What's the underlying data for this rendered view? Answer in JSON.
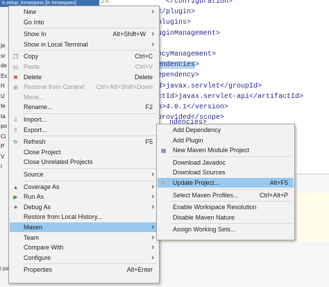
{
  "project_explorer": {
    "header_title": "e.setup_inmaspass [in inmaspass]",
    "stubs": [
      "ja",
      "sr",
      "de",
      "Ec",
      "H",
      "U",
      "te",
      "ta",
      "po",
      "Ci",
      "P",
      "V",
      "i"
    ],
    "bottom_tab": "i pa"
  },
  "editor": {
    "line_number": "24",
    "lines": [
      {
        "pre": "",
        "hl": "",
        "text": "  </configuration>"
      },
      {
        "pre": "",
        "hl": "",
        "text": "</plugin>"
      },
      {
        "pre": "",
        "hl": "",
        "text": "plugins>"
      },
      {
        "pre": "",
        "hl": "",
        "text": "uginManagement>"
      },
      {
        "pre": "",
        "hl": "",
        "text": ""
      },
      {
        "pre": "",
        "hl": "",
        "text": "ncyManagement>"
      },
      {
        "pre": "",
        "hl": "endencies",
        "text": ">"
      },
      {
        "pre": "",
        "hl": "",
        "text": "ependency>"
      },
      {
        "pre": "",
        "hl": "",
        "text": "d>javax.servlet</groupId>"
      },
      {
        "pre": "",
        "hl": "",
        "text": "ctId>javax.servlet-api</artifactId>"
      },
      {
        "pre": "",
        "hl": "",
        "text": "n>4.0.1</version>"
      },
      {
        "pre": "",
        "hl": "",
        "text": "provided</scope>"
      }
    ],
    "partial_line": "ndencies>"
  },
  "context_menu": {
    "items": [
      {
        "label": "New",
        "submenu": true
      },
      {
        "label": "Go Into"
      },
      {
        "sep": true
      },
      {
        "label": "Show In",
        "shortcut": "Alt+Shift+W",
        "submenu": true
      },
      {
        "label": "Show in Local Terminal",
        "submenu": true
      },
      {
        "sep": true
      },
      {
        "label": "Copy",
        "shortcut": "Ctrl+C",
        "icon": "copy-icon"
      },
      {
        "label": "Paste",
        "shortcut": "Ctrl+V",
        "icon": "paste-icon",
        "disabled": true
      },
      {
        "label": "Delete",
        "shortcut": "Delete",
        "icon": "delete-icon"
      },
      {
        "label": "Remove from Context",
        "shortcut": "Ctrl+Alt+Shift+Down",
        "icon": "remove-context-icon",
        "disabled": true
      },
      {
        "label": "Move...",
        "disabled": true
      },
      {
        "label": "Rename...",
        "shortcut": "F2"
      },
      {
        "sep": true
      },
      {
        "label": "Import...",
        "icon": "import-icon"
      },
      {
        "label": "Export...",
        "icon": "export-icon"
      },
      {
        "sep": true
      },
      {
        "label": "Refresh",
        "shortcut": "F5",
        "icon": "refresh-icon"
      },
      {
        "label": "Close Project"
      },
      {
        "label": "Close Unrelated Projects"
      },
      {
        "sep": true
      },
      {
        "label": "Source",
        "submenu": true
      },
      {
        "sep": true
      },
      {
        "label": "Coverage As",
        "icon": "coverage-icon",
        "submenu": true
      },
      {
        "label": "Run As",
        "icon": "run-icon",
        "submenu": true
      },
      {
        "label": "Debug As",
        "icon": "debug-icon",
        "submenu": true
      },
      {
        "label": "Restore from Local History..."
      },
      {
        "label": "Maven",
        "submenu": true,
        "active": true
      },
      {
        "label": "Team",
        "submenu": true
      },
      {
        "label": "Compare With",
        "submenu": true
      },
      {
        "label": "Configure",
        "submenu": true
      },
      {
        "sep": true
      },
      {
        "label": "Properties",
        "shortcut": "Alt+Enter"
      }
    ]
  },
  "maven_submenu": {
    "items": [
      {
        "label": "Add Dependency"
      },
      {
        "label": "Add Plugin"
      },
      {
        "label": "New Maven Module Project",
        "icon": "maven-module-icon"
      },
      {
        "sep": true
      },
      {
        "label": "Download Javadoc"
      },
      {
        "label": "Download Sources"
      },
      {
        "label": "Update Project...",
        "shortcut": "Alt+F5",
        "icon": "update-project-icon",
        "active": true
      },
      {
        "sep": true
      },
      {
        "label": "Select Maven Profiles...",
        "shortcut": "Ctrl+Alt+P"
      },
      {
        "sep": true
      },
      {
        "label": "Enable Workspace Resolution"
      },
      {
        "label": "Disable Maven Nature"
      },
      {
        "sep": true
      },
      {
        "label": "Assign Working Sets..."
      }
    ]
  },
  "colors": {
    "highlight": "#99c9ef",
    "menu_bg": "#f2f2f2",
    "code_tag": "#26268a",
    "selection": "#b8d5f2"
  }
}
